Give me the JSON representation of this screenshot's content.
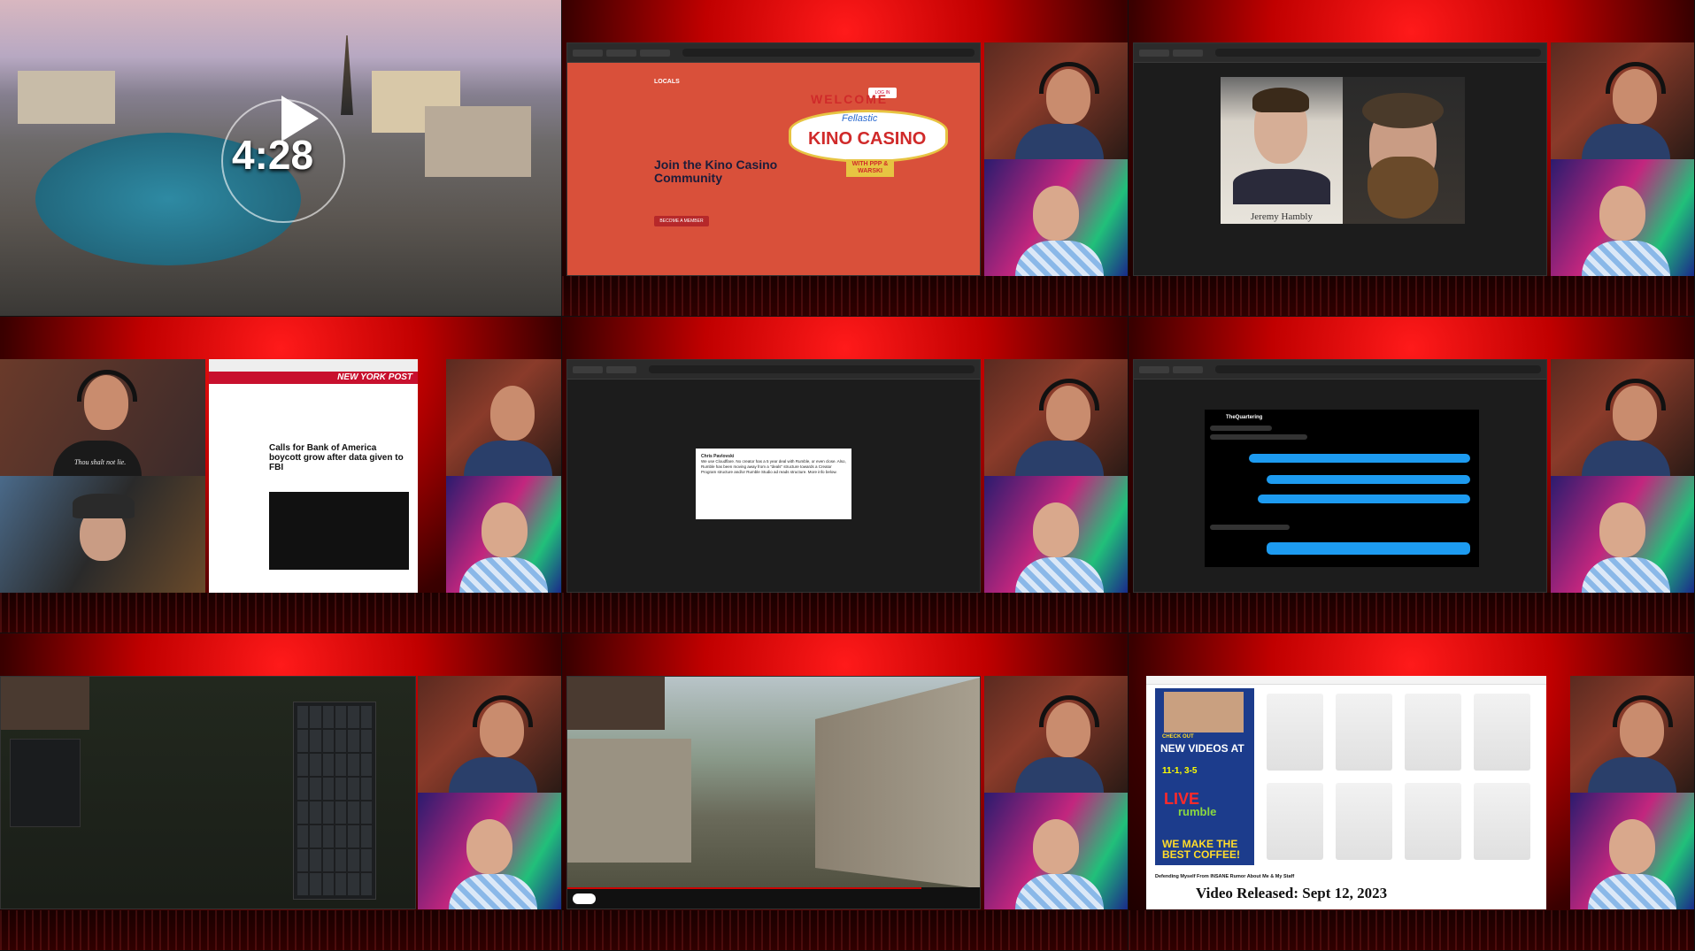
{
  "cell1": {
    "timer": "4:28"
  },
  "cell2": {
    "brand": "LOCALS",
    "login": "LOG IN",
    "headline": "Join the Kino Casino Community",
    "cta": "BECOME A MEMBER",
    "sign_welcome": "WELCOME",
    "sign_fell": "Fellastic",
    "sign_kino": "KINO CASINO",
    "sign_with": "WITH PPP & WARSKI"
  },
  "cell3": {
    "caption": "Jeremy Hambly"
  },
  "cell4": {
    "masthead": "NEW YORK POST",
    "headline": "Calls for Bank of America boycott grow after data given to FBI",
    "shirt_text": "Thou shalt not lie."
  },
  "cell5": {
    "tweet_name": "Chris Pavlovski",
    "tweet_text": "We use Cloudflare. No creator has a 5 year deal with Rumble, or even close. Also, Rumble has been moving away from a \"deals\" structure towards a Creator Program structure and/or Rumble Studio ad reads structure. More info below."
  },
  "cell6": {
    "chat_name": "TheQuartering"
  },
  "cell9": {
    "promo_check": "CHECK OUT",
    "promo_new": "NEW VIDEOS AT",
    "promo_dates": "11-1, 3-5",
    "promo_live": "LIVE",
    "promo_rumble": "rumble",
    "promo_best": "WE MAKE THE BEST COFFEE!",
    "video_title": "Defending Myself From INSANE Rumor About Me & My Staff",
    "caption": "Video Released: Sept 12, 2023"
  }
}
